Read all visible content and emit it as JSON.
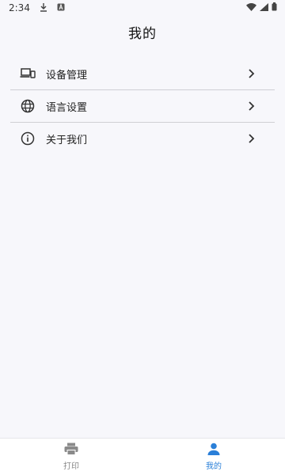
{
  "status_bar": {
    "time": "2:34",
    "left_icons": [
      "download-icon",
      "a-badge-icon"
    ],
    "right_icons": [
      "wifi-icon",
      "signal-icon",
      "battery-icon"
    ]
  },
  "header": {
    "title": "我的"
  },
  "menu": {
    "items": [
      {
        "label": "设备管理",
        "icon": "devices-icon"
      },
      {
        "label": "语言设置",
        "icon": "globe-icon"
      },
      {
        "label": "关于我们",
        "icon": "info-icon"
      }
    ]
  },
  "bottom_nav": {
    "items": [
      {
        "label": "打印",
        "icon": "printer-icon",
        "active": false
      },
      {
        "label": "我的",
        "icon": "person-icon",
        "active": true
      }
    ]
  },
  "colors": {
    "accent": "#2a7fd8",
    "inactive": "#8a8a8a",
    "background": "#f7f7fb"
  }
}
